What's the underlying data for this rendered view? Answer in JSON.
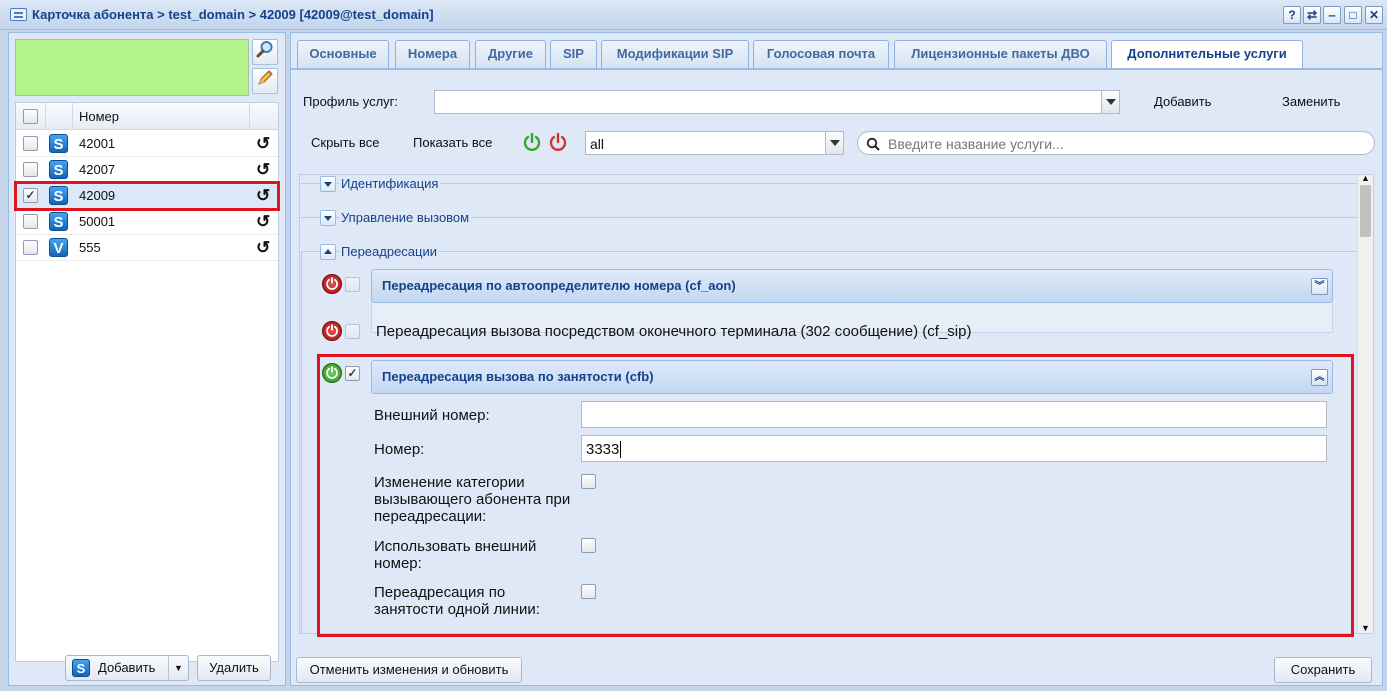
{
  "window": {
    "title": "Карточка абонента > test_domain > 42009 [42009@test_domain]",
    "controls": [
      "?",
      "⇄",
      "‒",
      "□",
      "✕"
    ]
  },
  "left": {
    "grid_header": "Номер",
    "rows": [
      {
        "number": "42001",
        "type": "S",
        "checked": false
      },
      {
        "number": "42007",
        "type": "S",
        "checked": false
      },
      {
        "number": "42009",
        "type": "S",
        "checked": true
      },
      {
        "number": "50001",
        "type": "S",
        "checked": false
      },
      {
        "number": "555",
        "type": "V",
        "checked": false
      }
    ],
    "add_label": "Добавить",
    "delete_label": "Удалить"
  },
  "tabs": [
    "Основные",
    "Номера",
    "Другие",
    "SIP",
    "Модификации SIP",
    "Голосовая почта",
    "Лицензионные пакеты ДВО",
    "Дополнительные услуги"
  ],
  "active_tab": "Дополнительные услуги",
  "profile": {
    "label": "Профиль услуг:",
    "value": "",
    "add_label": "Добавить",
    "replace_label": "Заменить"
  },
  "toolbar": {
    "hide_all": "Скрыть все",
    "show_all": "Показать все",
    "filter_value": "all",
    "search_placeholder": "Введите название услуги..."
  },
  "sections": {
    "identification": "Идентификация",
    "call_control": "Управление вызовом",
    "forwarding": "Переадресации"
  },
  "services": {
    "cf_aon": "Переадресация по автоопределителю номера (cf_aon)",
    "cf_sip": "Переадресация вызова посредством оконечного терминала (302 сообщение) (cf_sip)",
    "cfb": "Переадресация вызова по занятости (cfb)"
  },
  "cfb_form": {
    "external_number_label": "Внешний номер:",
    "external_number_value": "",
    "number_label": "Номер:",
    "number_value": "3333",
    "category_change_label": "Изменение категории вызывающего абонента при переадресации:",
    "use_external_label": "Использовать внешний номер:",
    "single_line_label": "Переадресация по занятости одной линии:"
  },
  "footer": {
    "cancel_label": "Отменить изменения и обновить",
    "save_label": "Сохранить"
  },
  "colors": {
    "highlight": "#e0141e",
    "accent": "#15428b",
    "green_box": "#b3f38c"
  }
}
